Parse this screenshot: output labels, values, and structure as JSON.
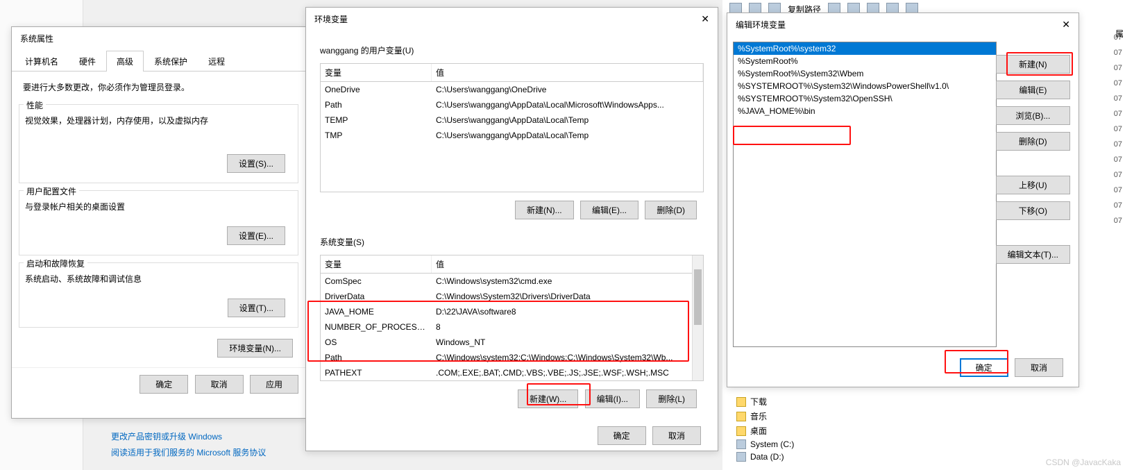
{
  "left_bg_link1": "更改产品密钥或升级 Windows",
  "left_bg_link2": "阅读适用于我们服务的 Microsoft 服务协议",
  "bg": {
    "copy_path": "复制路径",
    "tree": {
      "downloads": "下载",
      "music": "音乐",
      "desktop": "桌面",
      "system": "System (C:)",
      "data": "Data (D:)"
    },
    "dates": [
      "07",
      "07",
      "07",
      "07",
      "07",
      "07",
      "07",
      "07",
      "07",
      "07",
      "07",
      "07",
      "07"
    ],
    "watermark": "CSDN @JavacKaka",
    "right_label": "属"
  },
  "dlg1": {
    "title": "系统属性",
    "tabs": [
      "计算机名",
      "硬件",
      "高级",
      "系统保护",
      "远程"
    ],
    "active_tab": 2,
    "note": "要进行大多数更改，你必须作为管理员登录。",
    "perf_title": "性能",
    "perf_text": "视觉效果，处理器计划，内存使用，以及虚拟内存",
    "prof_title": "用户配置文件",
    "prof_text": "与登录帐户相关的桌面设置",
    "start_title": "启动和故障恢复",
    "start_text": "系统启动、系统故障和调试信息",
    "settings_s": "设置(S)...",
    "settings_e": "设置(E)...",
    "settings_t": "设置(T)...",
    "env_btn": "环境变量(N)...",
    "ok": "确定",
    "cancel": "取消",
    "apply": "应用"
  },
  "dlg2": {
    "title": "环境变量",
    "user_label": "wanggang 的用户变量(U)",
    "sys_label": "系统变量(S)",
    "col_var": "变量",
    "col_val": "值",
    "user_vars": [
      {
        "n": "OneDrive",
        "v": "C:\\Users\\wanggang\\OneDrive"
      },
      {
        "n": "Path",
        "v": "C:\\Users\\wanggang\\AppData\\Local\\Microsoft\\WindowsApps..."
      },
      {
        "n": "TEMP",
        "v": "C:\\Users\\wanggang\\AppData\\Local\\Temp"
      },
      {
        "n": "TMP",
        "v": "C:\\Users\\wanggang\\AppData\\Local\\Temp"
      }
    ],
    "sys_vars": [
      {
        "n": "ComSpec",
        "v": "C:\\Windows\\system32\\cmd.exe"
      },
      {
        "n": "DriverData",
        "v": "C:\\Windows\\System32\\Drivers\\DriverData"
      },
      {
        "n": "JAVA_HOME",
        "v": "D:\\22\\JAVA\\software8"
      },
      {
        "n": "NUMBER_OF_PROCESSORS",
        "v": "8"
      },
      {
        "n": "OS",
        "v": "Windows_NT"
      },
      {
        "n": "Path",
        "v": "C:\\Windows\\system32;C:\\Windows;C:\\Windows\\System32\\Wb..."
      },
      {
        "n": "PATHEXT",
        "v": ".COM;.EXE;.BAT;.CMD;.VBS;.VBE;.JS;.JSE;.WSF;.WSH;.MSC"
      }
    ],
    "new_n": "新建(N)...",
    "edit_e": "编辑(E)...",
    "del_d": "删除(D)",
    "new_w": "新建(W)...",
    "edit_i": "编辑(I)...",
    "del_l": "删除(L)",
    "ok": "确定",
    "cancel": "取消"
  },
  "dlg3": {
    "title": "编辑环境变量",
    "paths": [
      "%SystemRoot%\\system32",
      "%SystemRoot%",
      "%SystemRoot%\\System32\\Wbem",
      "%SYSTEMROOT%\\System32\\WindowsPowerShell\\v1.0\\",
      "%SYSTEMROOT%\\System32\\OpenSSH\\",
      "%JAVA_HOME%\\bin"
    ],
    "selected": 0,
    "new_btn": "新建(N)",
    "edit_btn": "编辑(E)",
    "browse_btn": "浏览(B)...",
    "del_btn": "删除(D)",
    "up_btn": "上移(U)",
    "down_btn": "下移(O)",
    "edit_text": "编辑文本(T)...",
    "ok": "确定",
    "cancel": "取消"
  }
}
